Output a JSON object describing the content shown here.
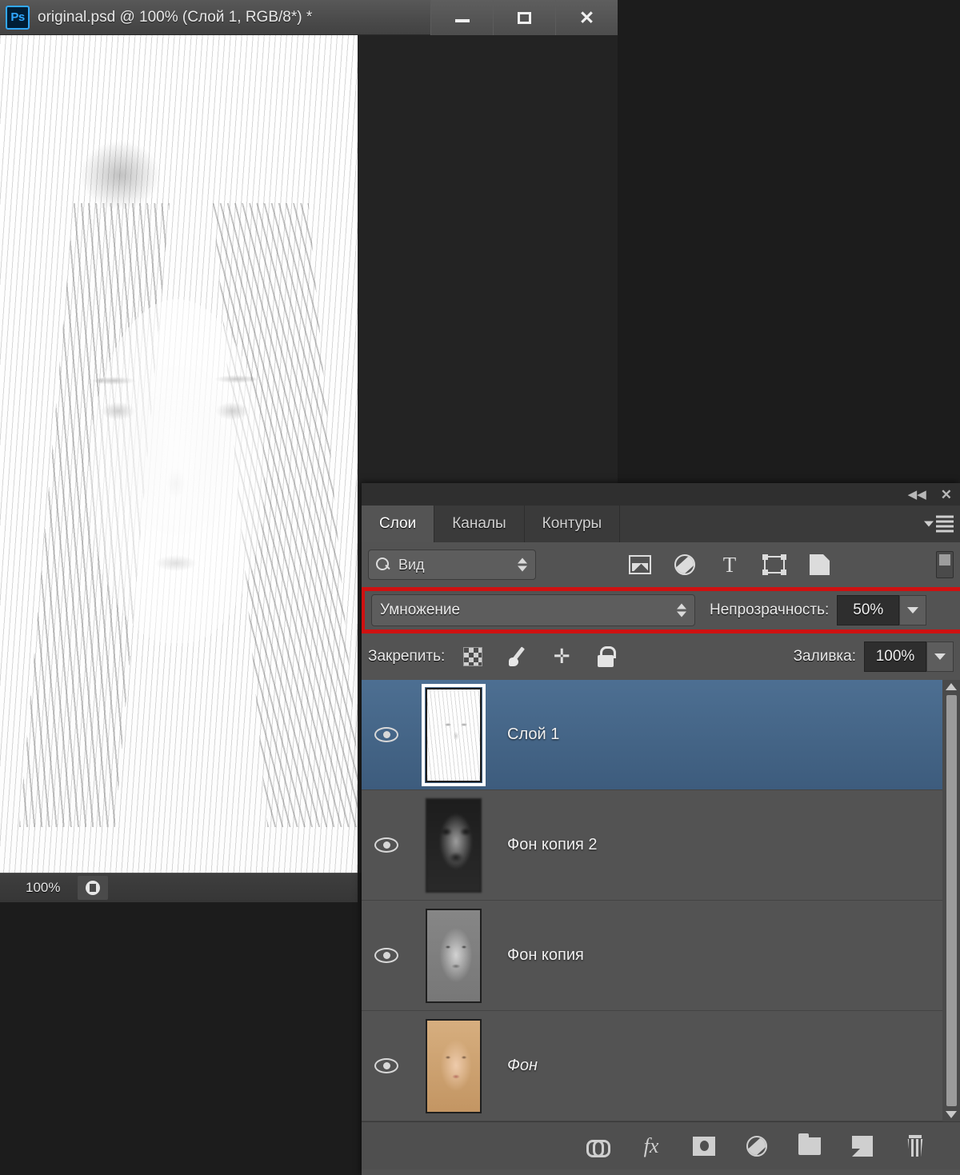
{
  "window": {
    "app_icon": "Ps",
    "title": "original.psd @ 100% (Слой 1, RGB/8*) *",
    "minimize_label": "—",
    "maximize_label": "□",
    "close_label": "✕"
  },
  "status": {
    "zoom": "100%",
    "doc_icon": "document-icon"
  },
  "panel": {
    "collapse_label": "◀◀",
    "close_label": "✕",
    "menu_label": "panel-menu",
    "tabs": [
      {
        "label": "Слои",
        "active": true
      },
      {
        "label": "Каналы",
        "active": false
      },
      {
        "label": "Контуры",
        "active": false
      }
    ],
    "filter": {
      "search_icon": "search-icon",
      "selected": "Вид",
      "type_icons": [
        "pixel-layer-icon",
        "adjustment-layer-icon",
        "type-layer-icon",
        "shape-layer-icon",
        "smart-object-icon"
      ],
      "toggle_label": "filter-enable-toggle"
    },
    "blend": {
      "mode": "Умножение",
      "opacity_label": "Непрозрачность:",
      "opacity_value": "50%",
      "highlight_color": "#cf1111"
    },
    "lock": {
      "label": "Закрепить:",
      "icons": [
        "lock-transparency-icon",
        "lock-pixels-icon",
        "lock-position-icon",
        "lock-all-icon"
      ],
      "fill_label": "Заливка:",
      "fill_value": "100%"
    },
    "layers": [
      {
        "name": "Слой 1",
        "selected": true,
        "visible": true,
        "locked": false,
        "italic": false,
        "thumb": "t-sketch"
      },
      {
        "name": "Фон копия 2",
        "selected": false,
        "visible": true,
        "locked": false,
        "italic": false,
        "thumb": "t-blur"
      },
      {
        "name": "Фон копия",
        "selected": false,
        "visible": true,
        "locked": false,
        "italic": false,
        "thumb": "t-bw"
      },
      {
        "name": "Фон",
        "selected": false,
        "visible": true,
        "locked": true,
        "italic": true,
        "thumb": "t-color"
      }
    ],
    "footer_icons": [
      "link-layers-icon",
      "layer-style-fx-icon",
      "layer-mask-icon",
      "adjustment-layer-icon",
      "new-group-icon",
      "new-layer-icon",
      "delete-layer-icon"
    ],
    "footer_fx_label": "fx"
  }
}
